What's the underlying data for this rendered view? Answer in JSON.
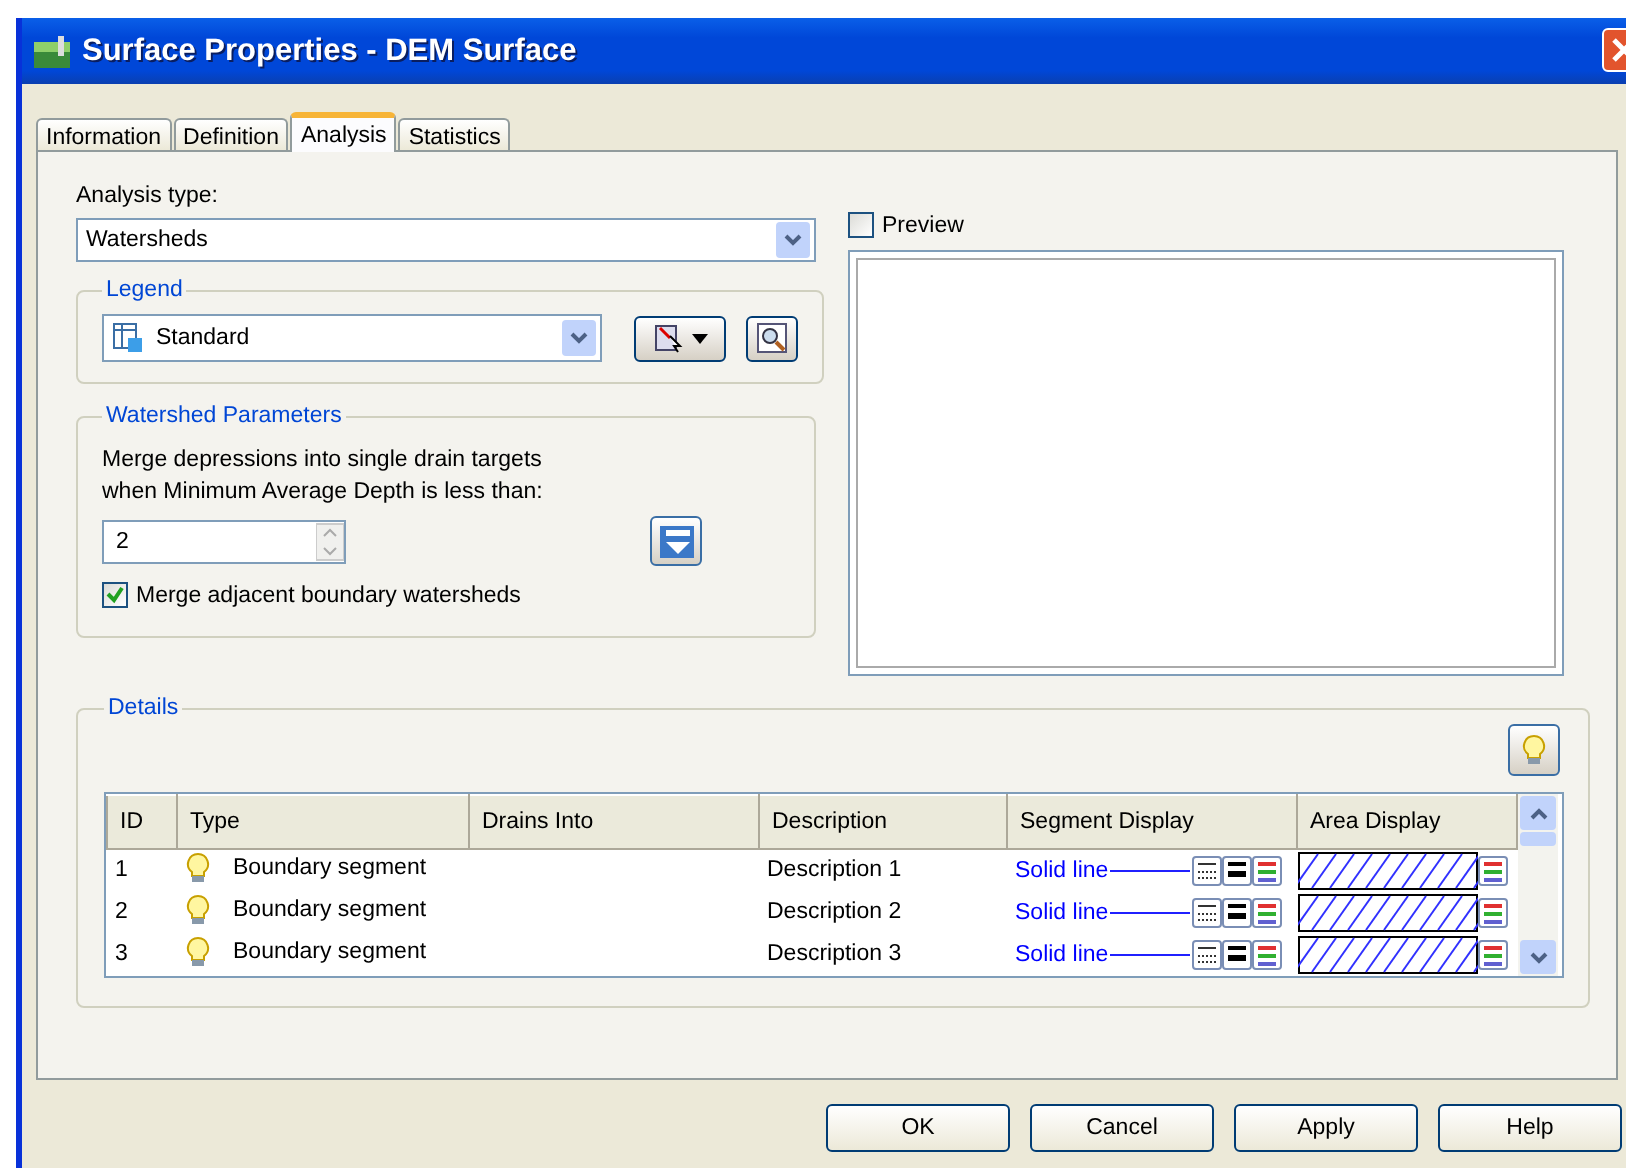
{
  "window": {
    "title": "Surface Properties - DEM Surface"
  },
  "tabs": [
    {
      "label": "Information",
      "selected": false
    },
    {
      "label": "Definition",
      "selected": false
    },
    {
      "label": "Analysis",
      "selected": true
    },
    {
      "label": "Statistics",
      "selected": false
    }
  ],
  "analysis_type": {
    "label": "Analysis type:",
    "value": "Watersheds"
  },
  "legend": {
    "title": "Legend",
    "value": "Standard"
  },
  "watershed_parameters": {
    "title": "Watershed Parameters",
    "description": "Merge depressions into single drain targets when Minimum Average Depth is less than:",
    "depth": "2",
    "merge": {
      "label": "Merge adjacent boundary watersheds",
      "checked": true
    }
  },
  "preview": {
    "label": "Preview",
    "checked": false
  },
  "details": {
    "title": "Details",
    "columns": [
      "ID",
      "Type",
      "Drains Into",
      "Description",
      "Segment Display",
      "Area Display"
    ],
    "rows": [
      {
        "id": "1",
        "type": "Boundary segment",
        "description": "Description 1",
        "segment_display": "Solid line"
      },
      {
        "id": "2",
        "type": "Boundary segment",
        "description": "Description 2",
        "segment_display": "Solid line"
      },
      {
        "id": "3",
        "type": "Boundary segment",
        "description": "Description 3",
        "segment_display": "Solid line"
      }
    ]
  },
  "buttons": [
    "OK",
    "Cancel",
    "Apply",
    "Help"
  ]
}
